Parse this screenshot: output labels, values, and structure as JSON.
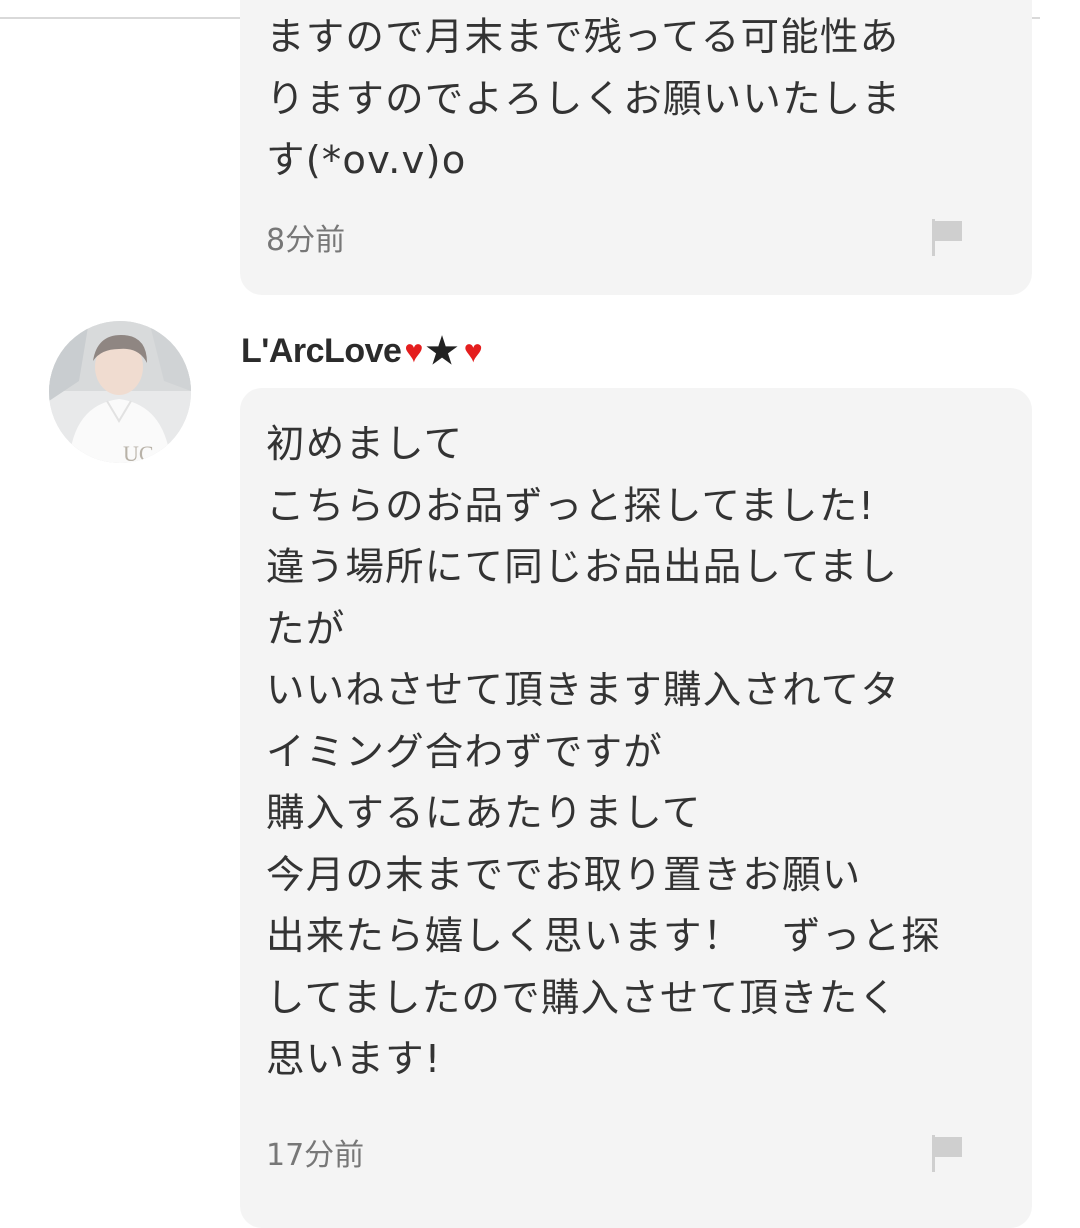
{
  "comments": [
    {
      "text": "ますので月末まで残ってる可能性あ\nりますのでよろしくお願いいたしま\nす(*ov.v)o",
      "time": "8分前"
    },
    {
      "username": "L'ArcLove",
      "username_symbols": {
        "heart": "♥",
        "star": "★"
      },
      "text": "初めまして\nこちらのお品ずっと探してました!\n違う場所にて同じお品出品してまし\nたが\nいいねさせて頂きます購入されてタ\nイミング合わずですが\n購入するにあたりまして\n今月の末まででお取り置きお願い\n出来たら嬉しく思います！　ずっと探\nしてましたので購入させて頂きたく\n思います!",
      "time": "17分前"
    }
  ],
  "icons": {
    "report": "flag-icon",
    "avatar": "user-avatar"
  },
  "colors": {
    "bubble": "#f4f4f4",
    "heart": "#e41e1e",
    "text": "#333333",
    "timestamp": "#777777",
    "flag": "#cfcfcf"
  }
}
